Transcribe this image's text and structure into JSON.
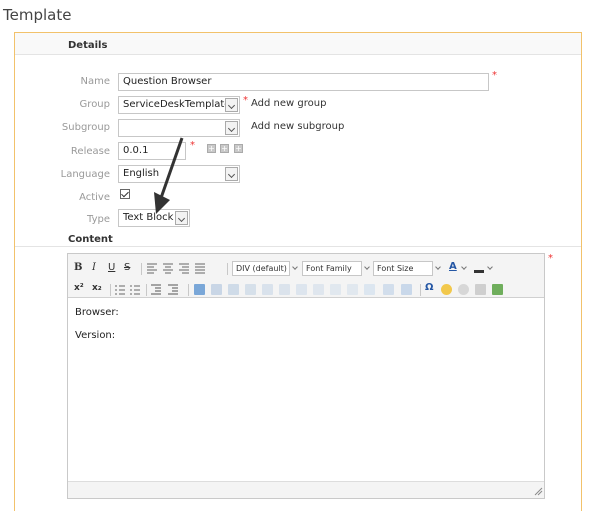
{
  "page": {
    "heading": "Template"
  },
  "details": {
    "section_title": "Details",
    "fields": {
      "name": {
        "label": "Name",
        "value": "Question Browser",
        "required": "*"
      },
      "group": {
        "label": "Group",
        "value": "ServiceDeskTemplates",
        "required": "*",
        "add_link": "Add new group"
      },
      "subgroup": {
        "label": "Subgroup",
        "value": "",
        "add_link": "Add new subgroup"
      },
      "release": {
        "label": "Release",
        "value": "0.0.1",
        "required": "*"
      },
      "language": {
        "label": "Language",
        "value": "English"
      },
      "active": {
        "label": "Active",
        "checked": true
      },
      "type": {
        "label": "Type",
        "value": "Text Block"
      }
    }
  },
  "content": {
    "section_title": "Content",
    "required": "*",
    "toolbar": {
      "bold": "B",
      "italic": "I",
      "underline": "U",
      "strike": "S",
      "format_select": "DIV (default)",
      "font_family": "Font Family",
      "font_size": "Font Size",
      "font_color": "A",
      "superscript": "x²",
      "subscript": "x₂",
      "special_char": "Ω"
    },
    "lines": [
      "Browser:",
      "Version:"
    ]
  },
  "colors": {
    "panel_border": "#f2c26b",
    "required": "#e33333",
    "arrow": "#333333"
  }
}
